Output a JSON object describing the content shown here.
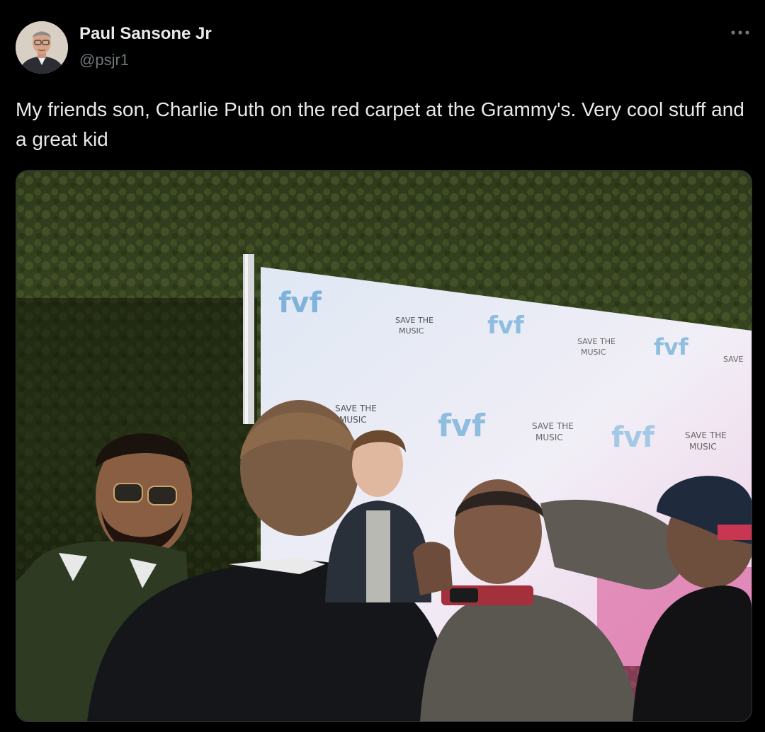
{
  "tweet": {
    "author": {
      "display_name": "Paul Sansone Jr",
      "handle": "@psjr1",
      "avatar_icon": "profile-photo"
    },
    "more_icon": "ellipsis-icon",
    "text": "My friends son, Charlie Puth on the red carpet at the Grammy's. Very cool stuff and a great kid",
    "media": {
      "type": "photo",
      "backdrop_logos": [
        "SAVE THE MUSIC",
        "fvf"
      ]
    }
  },
  "colors": {
    "background": "#000000",
    "text_primary": "#e7e9ea",
    "text_secondary": "#71767b",
    "border": "#2f3336"
  }
}
